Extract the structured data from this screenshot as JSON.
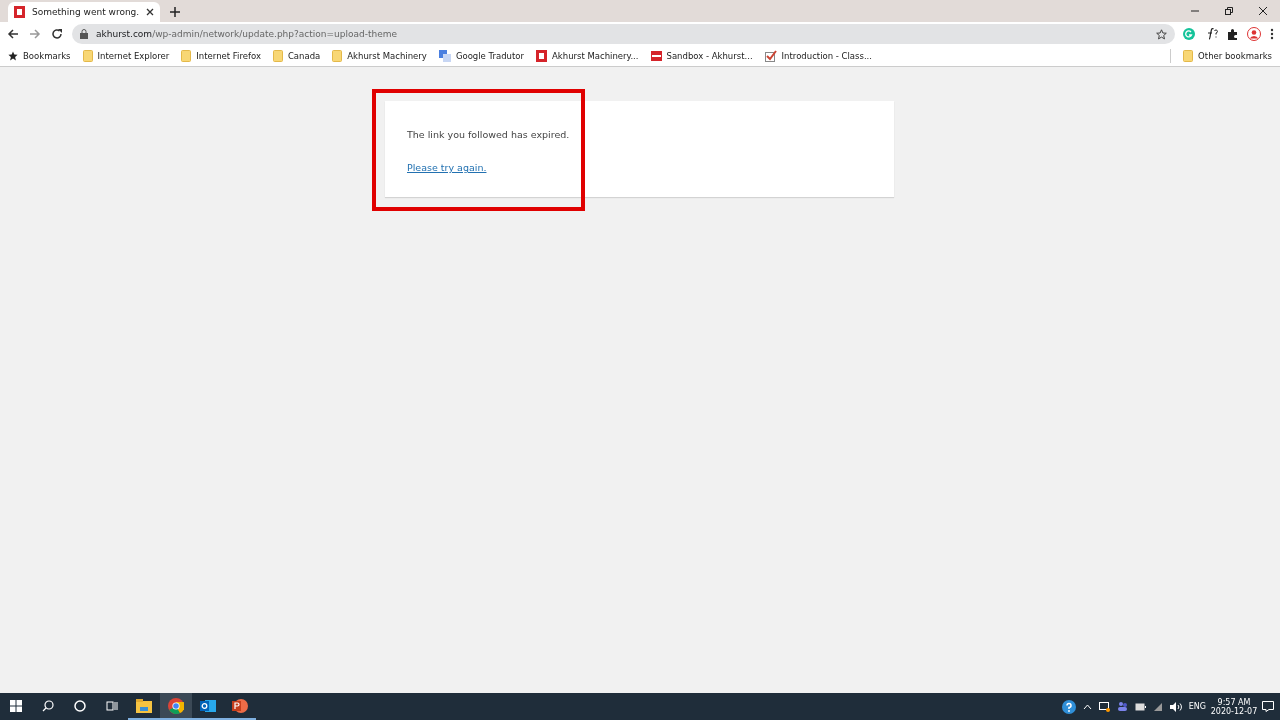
{
  "tabs": [
    {
      "title": "Something went wrong.",
      "selected": true
    }
  ],
  "address": {
    "host": "akhurst.com",
    "path": "/wp-admin/network/update.php?action=upload-theme"
  },
  "bookmarks": [
    {
      "label": "Bookmarks",
      "kind": "star"
    },
    {
      "label": "Internet Explorer",
      "kind": "folder"
    },
    {
      "label": "Internet Firefox",
      "kind": "folder"
    },
    {
      "label": "Canada",
      "kind": "folder"
    },
    {
      "label": "Akhurst Machinery",
      "kind": "folder"
    },
    {
      "label": "Google Tradutor",
      "kind": "translate"
    },
    {
      "label": "Akhurst Machinery...",
      "kind": "site"
    },
    {
      "label": "Sandbox - Akhurst...",
      "kind": "sandbox"
    },
    {
      "label": "Introduction - Class...",
      "kind": "check"
    }
  ],
  "other_bookmarks": "Other bookmarks",
  "message": {
    "text": "The link you followed has expired.",
    "link": "Please try again."
  },
  "highlight": {
    "color": "#e00000"
  },
  "taskbar": {
    "apps": [
      {
        "kind": "files",
        "selected": false
      },
      {
        "kind": "chrome",
        "selected": true
      },
      {
        "kind": "outlook",
        "selected": false
      },
      {
        "kind": "powerpoint",
        "selected": false
      }
    ],
    "language": "ENG",
    "time": "9:57 AM",
    "date": "2020-12-07"
  }
}
